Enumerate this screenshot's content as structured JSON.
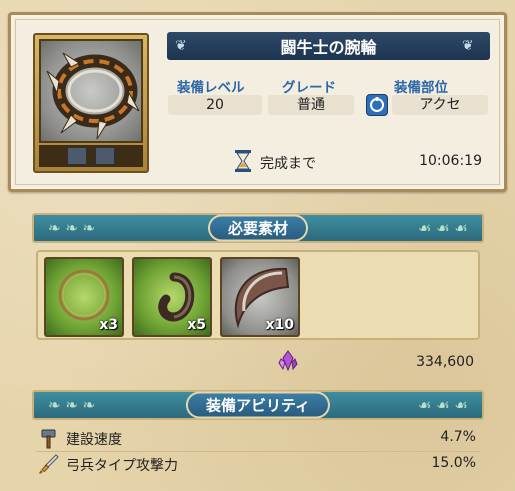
{
  "item": {
    "name": "闘牛士の腕輪",
    "level_label": "装備レベル",
    "level_value": "20",
    "grade_label": "グレード",
    "grade_value": "普通",
    "slot_label": "装備部位",
    "slot_value": "アクセ",
    "timer_label": "完成まで",
    "timer_value": "10:06:19"
  },
  "materials": {
    "header": "必要素材",
    "items": [
      {
        "icon": "green-ring-icon",
        "count": "x3"
      },
      {
        "icon": "horn-hook-icon",
        "count": "x5"
      },
      {
        "icon": "curved-horn-icon",
        "count": "x10"
      }
    ],
    "cost_icon": "purple-crystal-icon",
    "cost_value": "334,600"
  },
  "abilities": {
    "header": "装備アビリティ",
    "items": [
      {
        "icon": "hammer-icon",
        "name": "建設速度",
        "value": "4.7%"
      },
      {
        "icon": "sword-icon",
        "name": "弓兵タイプ攻撃力",
        "value": "15.0%"
      }
    ]
  },
  "colors": {
    "banner": "#1d3450",
    "label_blue": "#2b67a8",
    "section_teal": "#2c6b7d"
  }
}
